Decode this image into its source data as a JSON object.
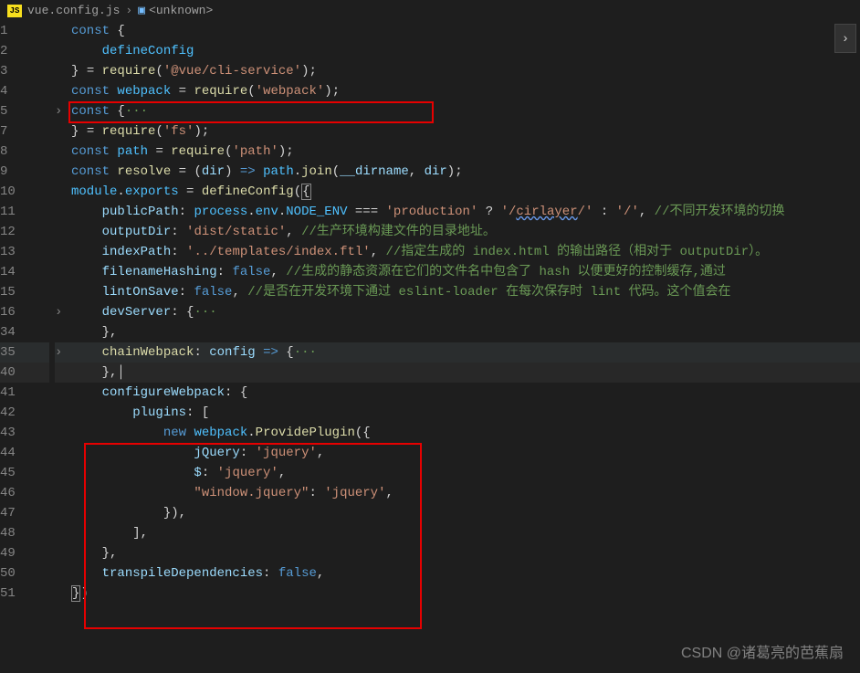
{
  "breadcrumb": {
    "icon_label": "JS",
    "file": "vue.config.js",
    "unknown": "<unknown>"
  },
  "drop_arrow": "›",
  "lines": [
    {
      "n": 1,
      "fold": "",
      "html": "<span class='kw'>const</span> <span class='punc'>{</span>"
    },
    {
      "n": 2,
      "fold": "",
      "html": "    <span class='cv'>defineConfig</span>"
    },
    {
      "n": 3,
      "fold": "",
      "html": "<span class='punc'>}</span> <span class='op'>=</span> <span class='fn'>require</span><span class='punc'>(</span><span class='str'>'@vue/cli-service'</span><span class='punc'>);</span>"
    },
    {
      "n": 4,
      "fold": "",
      "html": "<span class='kw'>const</span> <span class='cv'>webpack</span> <span class='op'>=</span> <span class='fn'>require</span><span class='punc'>(</span><span class='str'>'webpack'</span><span class='punc'>);</span>"
    },
    {
      "n": 5,
      "fold": "›",
      "html": "<span class='kw'>const</span> <span class='punc'>{</span><span class='cmt'>···</span>"
    },
    {
      "n": 7,
      "fold": "",
      "html": "<span class='punc'>}</span> <span class='op'>=</span> <span class='fn'>require</span><span class='punc'>(</span><span class='str'>'fs'</span><span class='punc'>);</span>"
    },
    {
      "n": 8,
      "fold": "",
      "html": "<span class='kw'>const</span> <span class='cv'>path</span> <span class='op'>=</span> <span class='fn'>require</span><span class='punc'>(</span><span class='str'>'path'</span><span class='punc'>);</span>"
    },
    {
      "n": 9,
      "fold": "",
      "html": "<span class='kw'>const</span> <span class='fn'>resolve</span> <span class='op'>=</span> <span class='punc'>(</span><span class='var'>dir</span><span class='punc'>)</span> <span class='kw'>=&gt;</span> <span class='cv'>path</span><span class='punc'>.</span><span class='fn'>join</span><span class='punc'>(</span><span class='var'>__dirname</span><span class='punc'>,</span> <span class='var'>dir</span><span class='punc'>);</span>"
    },
    {
      "n": 10,
      "fold": "",
      "html": "<span class='cv'>module</span><span class='punc'>.</span><span class='cv'>exports</span> <span class='op'>=</span> <span class='fn'>defineConfig</span><span class='punc'>(</span><span class='punc paren-hl'>{</span>"
    },
    {
      "n": 11,
      "fold": "",
      "html": "    <span class='var'>publicPath</span><span class='punc'>:</span> <span class='cv'>process</span><span class='punc'>.</span><span class='cv'>env</span><span class='punc'>.</span><span class='cv'>NODE_ENV</span> <span class='op'>===</span> <span class='str'>'production'</span> <span class='op'>?</span> <span class='str'>'/<span class='underline'>cirlayer</span>/'</span> <span class='op'>:</span> <span class='str'>'/'</span><span class='punc'>,</span> <span class='cmt'>//不同开发环境的切换</span>"
    },
    {
      "n": 12,
      "fold": "",
      "html": "    <span class='var'>outputDir</span><span class='punc'>:</span> <span class='str'>'dist/static'</span><span class='punc'>,</span> <span class='cmt'>//生产环境构建文件的目录地址。</span>"
    },
    {
      "n": 13,
      "fold": "",
      "html": "    <span class='var'>indexPath</span><span class='punc'>:</span> <span class='str'>'../templates/index.ftl'</span><span class='punc'>,</span> <span class='cmt'>//指定生成的 index.html 的输出路径（相对于 outputDir）。</span>"
    },
    {
      "n": 14,
      "fold": "",
      "html": "    <span class='var'>filenameHashing</span><span class='punc'>:</span> <span class='kw'>false</span><span class='punc'>,</span> <span class='cmt'>//生成的静态资源在它们的文件名中包含了 hash 以便更好的控制缓存,通过</span>"
    },
    {
      "n": 15,
      "fold": "",
      "html": "    <span class='var'>lintOnSave</span><span class='punc'>:</span> <span class='kw'>false</span><span class='punc'>,</span> <span class='cmt'>//是否在开发环境下通过 eslint-loader 在每次保存时 lint 代码。这个值会在</span>"
    },
    {
      "n": 16,
      "fold": "›",
      "html": "    <span class='var'>devServer</span><span class='punc'>:</span> <span class='punc'>{</span><span class='cmt'>···</span>"
    },
    {
      "n": 34,
      "fold": "",
      "html": "    <span class='punc'>},</span>"
    },
    {
      "n": 35,
      "fold": "›",
      "hl": true,
      "html": "    <span class='fn'>chainWebpack</span><span class='punc'>:</span> <span class='var'>config</span> <span class='kw'>=&gt;</span> <span class='punc'>{</span><span class='cmt'>···</span>"
    },
    {
      "n": 40,
      "fold": "",
      "cursor": true,
      "html": "    <span class='punc'>},</span>│"
    },
    {
      "n": 41,
      "fold": "",
      "html": "    <span class='var'>configureWebpack</span><span class='punc'>:</span> <span class='punc'>{</span>"
    },
    {
      "n": 42,
      "fold": "",
      "html": "        <span class='var'>plugins</span><span class='punc'>:</span> <span class='punc'>[</span>"
    },
    {
      "n": 43,
      "fold": "",
      "html": "            <span class='kw'>new</span> <span class='cv'>webpack</span><span class='punc'>.</span><span class='fn'>ProvidePlugin</span><span class='punc'>({</span>"
    },
    {
      "n": 44,
      "fold": "",
      "html": "                <span class='var'>jQuery</span><span class='punc'>:</span> <span class='str'>'jquery'</span><span class='punc'>,</span>"
    },
    {
      "n": 45,
      "fold": "",
      "html": "                <span class='var'>$</span><span class='punc'>:</span> <span class='str'>'jquery'</span><span class='punc'>,</span>"
    },
    {
      "n": 46,
      "fold": "",
      "html": "                <span class='str'>\"window.jquery\"</span><span class='punc'>:</span> <span class='str'>'jquery'</span><span class='punc'>,</span>"
    },
    {
      "n": 47,
      "fold": "",
      "html": "            <span class='punc'>}),</span>"
    },
    {
      "n": 48,
      "fold": "",
      "html": "        <span class='punc'>],</span>"
    },
    {
      "n": 49,
      "fold": "",
      "html": "    <span class='punc'>},</span>"
    },
    {
      "n": 50,
      "fold": "",
      "html": "    <span class='var'>transpileDependencies</span><span class='punc'>:</span> <span class='kw'>false</span><span class='punc'>,</span>"
    },
    {
      "n": 51,
      "fold": "",
      "html": "<span class='punc paren-hl'>}</span><span class='punc'>)</span>"
    }
  ],
  "watermark": "CSDN @诸葛亮的芭蕉扇"
}
